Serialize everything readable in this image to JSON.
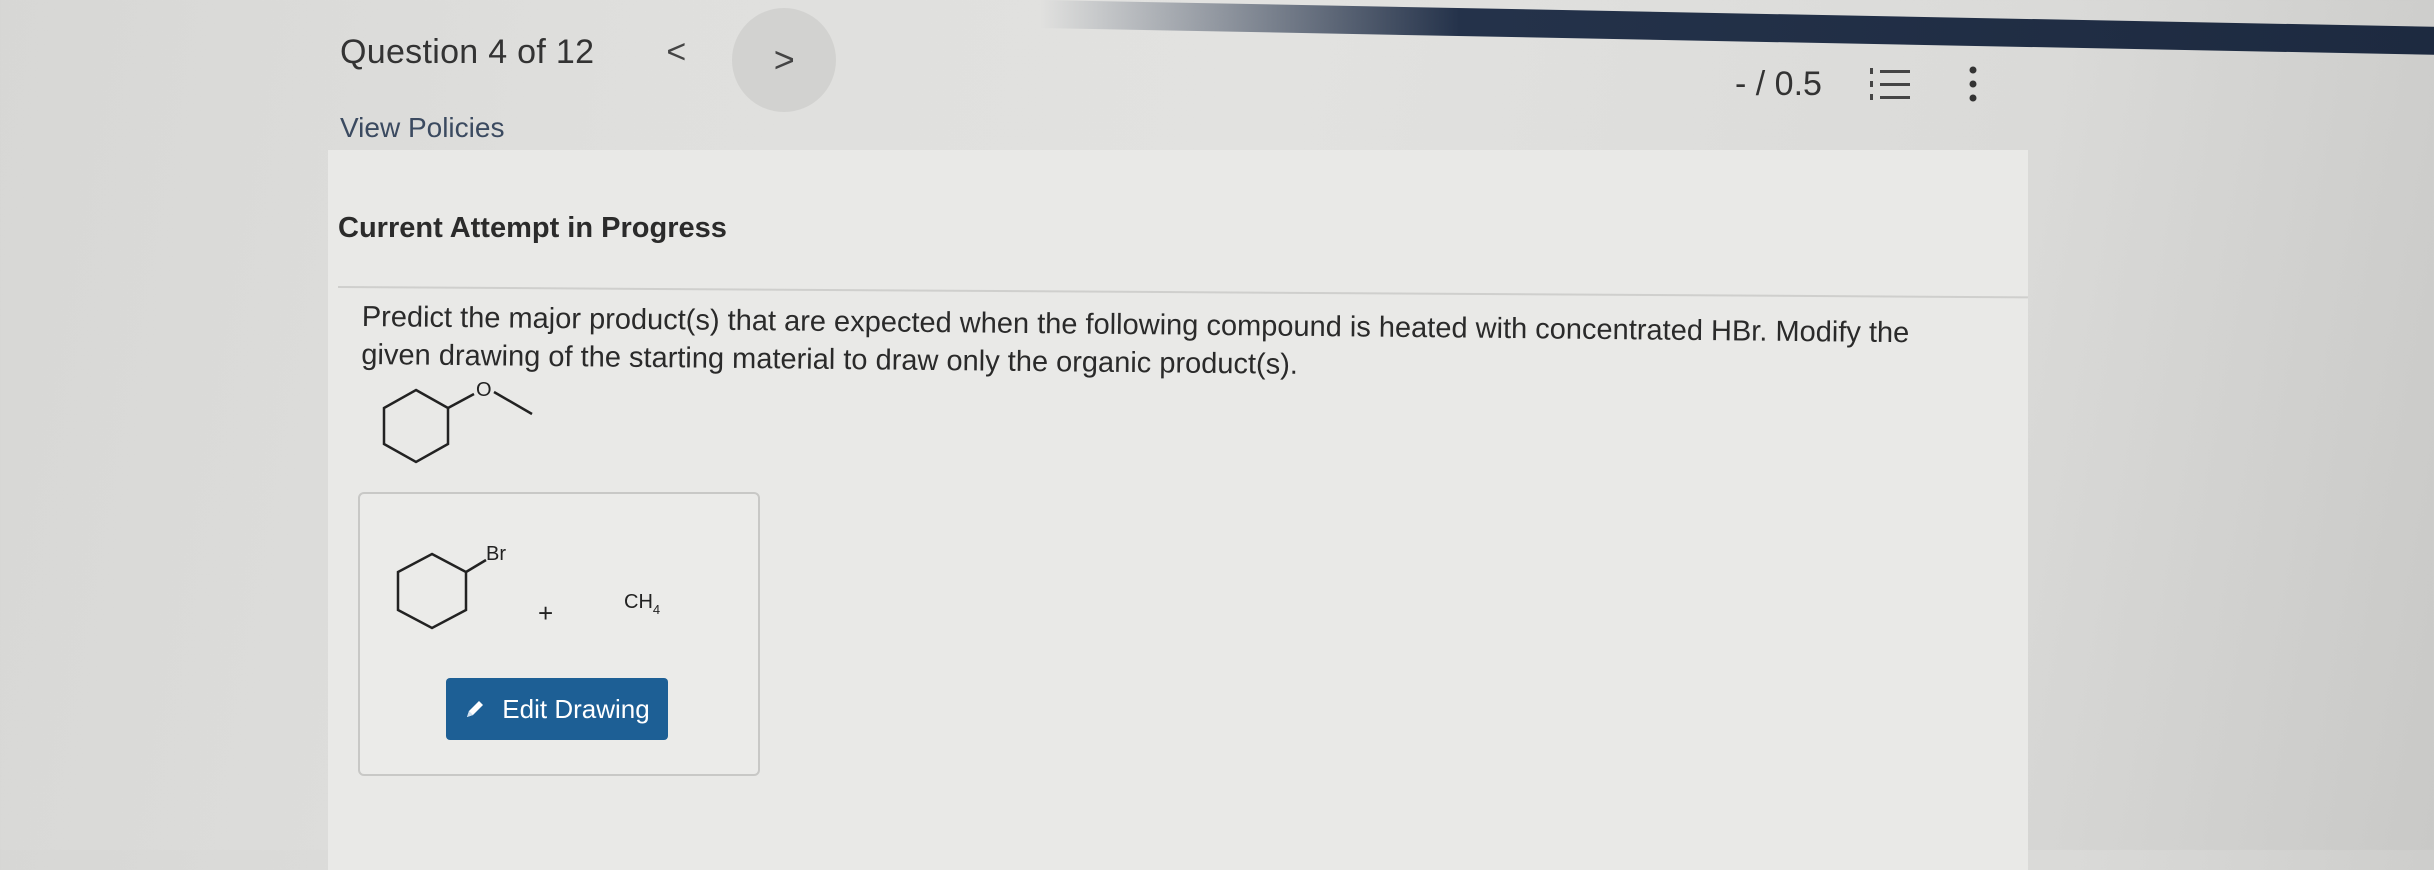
{
  "header": {
    "question_counter": "Question 4 of 12",
    "prev_glyph": "<",
    "next_glyph": ">",
    "view_policies": "View Policies",
    "score": "- / 0.5"
  },
  "icons": {
    "prev": "chevron-left-icon",
    "next": "chevron-right-icon",
    "question_list": "numbered-list-icon",
    "more": "vertical-ellipsis-icon",
    "edit": "pencil-icon"
  },
  "attempt": {
    "heading": "Current Attempt in Progress"
  },
  "question": {
    "text": "Predict the major product(s) that are expected when the following compound is heated with concentrated HBr. Modify the given drawing of the starting material to draw only the organic product(s).",
    "starting_material_atom_label": "O"
  },
  "answer": {
    "atom_label_br": "Br",
    "plus": "+",
    "methane_label": "CH",
    "methane_subscript": "4",
    "edit_button_label": "Edit Drawing"
  },
  "colors": {
    "button_bg": "#1d5f95",
    "link": "#3b4a60"
  }
}
